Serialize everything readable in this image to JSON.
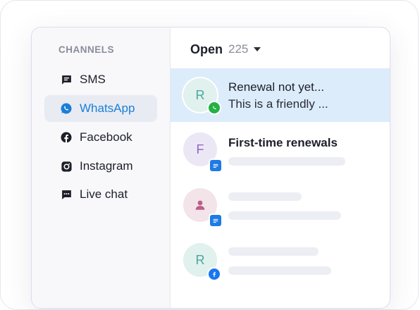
{
  "sidebar": {
    "heading": "CHANNELS",
    "items": [
      {
        "label": "SMS",
        "icon": "sms-icon",
        "active": false
      },
      {
        "label": "WhatsApp",
        "icon": "whatsapp-icon",
        "active": true
      },
      {
        "label": "Facebook",
        "icon": "facebook-icon",
        "active": false
      },
      {
        "label": "Instagram",
        "icon": "instagram-icon",
        "active": false
      },
      {
        "label": "Live chat",
        "icon": "live-chat-icon",
        "active": false
      }
    ]
  },
  "inbox": {
    "status_label": "Open",
    "count": "225",
    "conversations": [
      {
        "avatar_letter": "R",
        "title": "Renewal not yet...",
        "snippet": "This is a friendly ...",
        "channel": "whatsapp",
        "selected": true
      },
      {
        "avatar_letter": "F",
        "title": "First-time renewals",
        "snippet": "",
        "channel": "sms",
        "selected": false
      },
      {
        "avatar_letter": "",
        "title": "",
        "snippet": "",
        "channel": "sms",
        "selected": false
      },
      {
        "avatar_letter": "R",
        "title": "",
        "snippet": "",
        "channel": "facebook",
        "selected": false
      }
    ]
  },
  "colors": {
    "accent": "#1a7fd6",
    "selected_row": "#dcecfb",
    "whatsapp_green": "#25b145",
    "sms_blue": "#1e7be6",
    "facebook_blue": "#1877f2"
  }
}
